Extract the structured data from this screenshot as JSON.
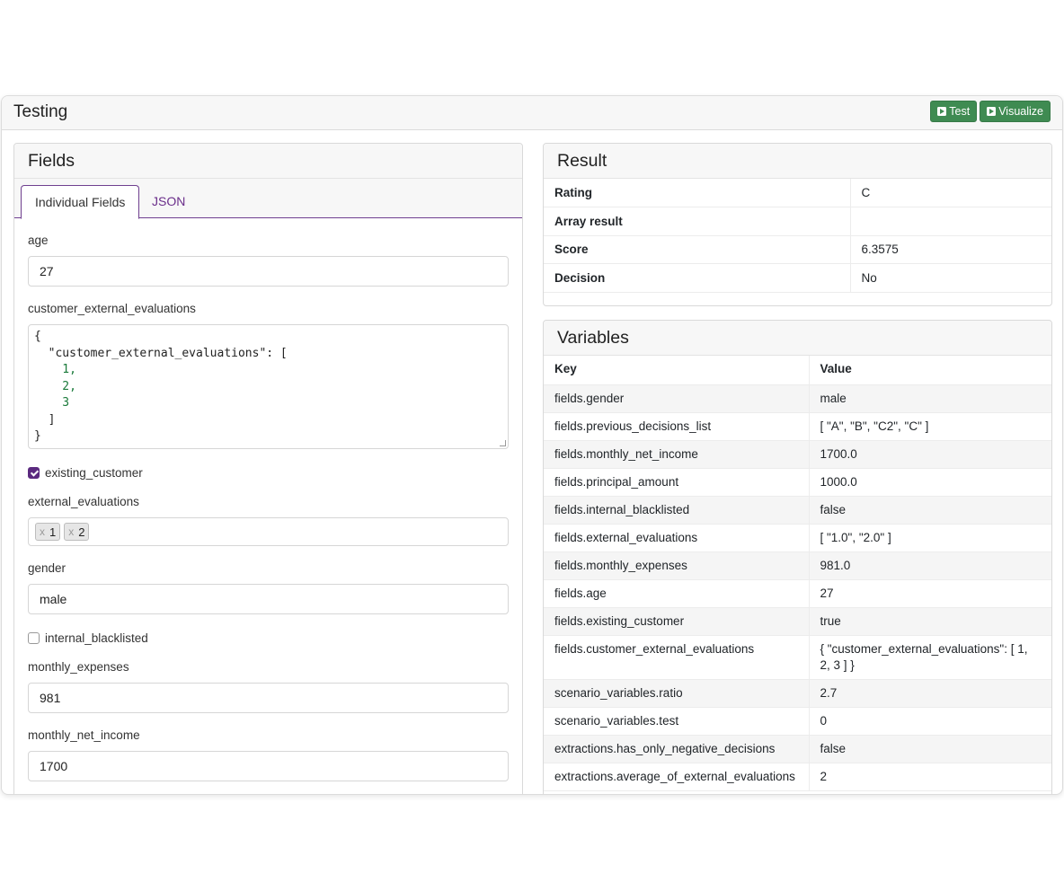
{
  "header": {
    "title": "Testing",
    "buttons": {
      "test": "Test",
      "visualize": "Visualize"
    }
  },
  "fields": {
    "title": "Fields",
    "tabs": {
      "individual": "Individual Fields",
      "json": "JSON"
    },
    "age": {
      "label": "age",
      "value": "27"
    },
    "customer_external_evaluations": {
      "label": "customer_external_evaluations",
      "lines": [
        "{",
        "  \"customer_external_evaluations\": [",
        "    1,",
        "    2,",
        "    3",
        "  ]",
        "}"
      ]
    },
    "existing_customer": {
      "label": "existing_customer",
      "checked": true
    },
    "external_evaluations": {
      "label": "external_evaluations",
      "tags": [
        "1",
        "2"
      ],
      "remove_glyph": "x"
    },
    "gender": {
      "label": "gender",
      "value": "male"
    },
    "internal_blacklisted": {
      "label": "internal_blacklisted",
      "checked": false
    },
    "monthly_expenses": {
      "label": "monthly_expenses",
      "value": "981"
    },
    "monthly_net_income": {
      "label": "monthly_net_income",
      "value": "1700"
    }
  },
  "result": {
    "title": "Result",
    "rows": [
      {
        "key": "Rating",
        "value": "C"
      },
      {
        "key": "Array result",
        "value": ""
      },
      {
        "key": "Score",
        "value": "6.3575"
      },
      {
        "key": "Decision",
        "value": "No"
      }
    ]
  },
  "variables": {
    "title": "Variables",
    "columns": {
      "key": "Key",
      "value": "Value"
    },
    "rows": [
      {
        "key": "fields.gender",
        "value": "male"
      },
      {
        "key": "fields.previous_decisions_list",
        "value": "[ \"A\", \"B\", \"C2\", \"C\" ]"
      },
      {
        "key": "fields.monthly_net_income",
        "value": "1700.0"
      },
      {
        "key": "fields.principal_amount",
        "value": "1000.0"
      },
      {
        "key": "fields.internal_blacklisted",
        "value": "false"
      },
      {
        "key": "fields.external_evaluations",
        "value": "[ \"1.0\", \"2.0\" ]"
      },
      {
        "key": "fields.monthly_expenses",
        "value": "981.0"
      },
      {
        "key": "fields.age",
        "value": "27"
      },
      {
        "key": "fields.existing_customer",
        "value": "true"
      },
      {
        "key": "fields.customer_external_evaluations",
        "value": "{ \"customer_external_evaluations\": [ 1, 2, 3 ] }"
      },
      {
        "key": "scenario_variables.ratio",
        "value": "2.7"
      },
      {
        "key": "scenario_variables.test",
        "value": "0"
      },
      {
        "key": "extractions.has_only_negative_decisions",
        "value": "false"
      },
      {
        "key": "extractions.average_of_external_evaluations",
        "value": "2"
      }
    ]
  },
  "colors": {
    "accent_purple": "#6f3f8f",
    "button_green": "#3f8b52"
  }
}
